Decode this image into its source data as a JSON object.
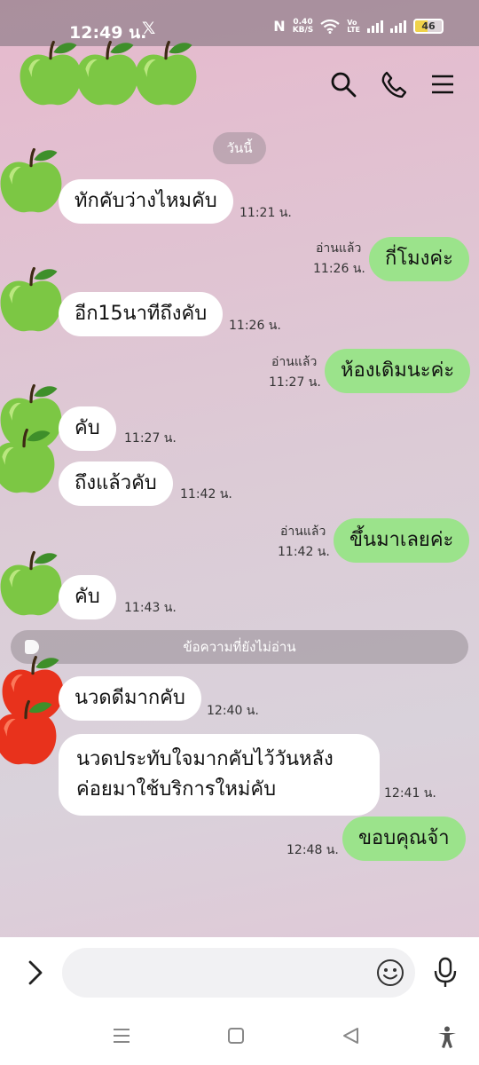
{
  "status_bar": {
    "time": "12:49 น.",
    "network_speed_value": "0.40",
    "network_speed_unit": "KB/S",
    "volte_top": "Vo",
    "volte_bottom": "LTE",
    "battery": "46"
  },
  "header": {
    "icons": [
      "search-icon",
      "phone-icon",
      "menu-icon"
    ]
  },
  "chat": {
    "date_label": "วันนี้",
    "messages": [
      {
        "text": "ทักคับว่างไหมคับ",
        "time": "11:21 น."
      },
      {
        "text": "กี่โมงค่ะ",
        "time": "11:26 น.",
        "read": "อ่านแล้ว"
      },
      {
        "text": "อีก15นาทีถึงคับ",
        "time": "11:26 น."
      },
      {
        "text": "ห้องเดิมนะค่ะ",
        "time": "11:27 น.",
        "read": "อ่านแล้ว"
      },
      {
        "text": "คับ",
        "time": "11:27 น."
      },
      {
        "text": "ถึงแล้วคับ",
        "time": "11:42 น."
      },
      {
        "text": "ขึ้นมาเลยค่ะ",
        "time": "11:42 น.",
        "read": "อ่านแล้ว"
      },
      {
        "text": "คับ",
        "time": "11:43 น."
      },
      {
        "text": "นวดดีมากคับ",
        "time": "12:40 น."
      },
      {
        "text_line1": "นวดประทับใจมากคับไว้วันหลัง",
        "text_line2": "ค่อยมาใช้บริการใหม่คับ",
        "time": "12:41 น."
      },
      {
        "text": "ขอบคุณจ้า",
        "time": "12:48 น."
      }
    ],
    "unread_divider": "ข้อความที่ยังไม่อ่าน"
  },
  "input": {
    "placeholder": ""
  },
  "colors": {
    "outgoing_bubble": "#9be38b",
    "incoming_bubble": "#ffffff",
    "green_apple": "#7cc744",
    "red_apple": "#e8321c"
  }
}
